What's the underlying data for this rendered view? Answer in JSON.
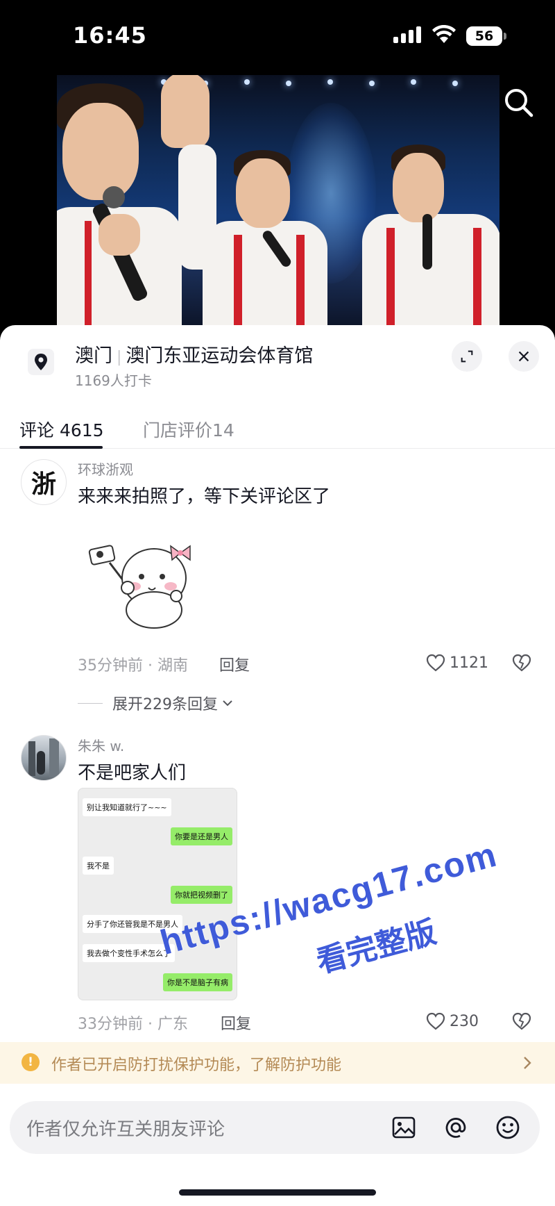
{
  "status_bar": {
    "time": "16:45",
    "battery": "56",
    "battery_level": 0.56
  },
  "location": {
    "city": "澳门",
    "venue": "澳门东亚运动会体育馆",
    "checkins": "1169人打卡"
  },
  "tabs": [
    {
      "label": "评论 4615",
      "active": true
    },
    {
      "label": "门店评价14",
      "active": false
    }
  ],
  "comments": [
    {
      "user": "环球浙观",
      "avatar_text": "浙",
      "text": "来来来拍照了，等下关评论区了",
      "sticker": "selfie-bear-sticker",
      "meta": "35分钟前 · 湖南",
      "reply_label": "回复",
      "likes": "1121"
    },
    {
      "user": "朱朱 w.",
      "text": "不是吧家人们",
      "meta": "33分钟前 · 广东",
      "reply_label": "回复",
      "likes": "230",
      "chat_screenshot": [
        {
          "side": "left",
          "text": "别让我知道就行了~~~"
        },
        {
          "side": "right",
          "text": "你要是还是男人"
        },
        {
          "side": "left",
          "text": "我不是"
        },
        {
          "side": "right",
          "text": "你就把视频删了"
        },
        {
          "side": "left",
          "text": "分手了你还管我是不是男人"
        },
        {
          "side": "left",
          "text": "我去做个变性手术怎么了"
        },
        {
          "side": "right",
          "text": "你是不是脑子有病"
        }
      ]
    }
  ],
  "expand_replies": "展开229条回复",
  "notice": "作者已开启防打扰保护功能，了解防护功能",
  "input": {
    "placeholder": "作者仅允许互关朋友评论"
  },
  "watermark": {
    "line1": "https://wacg17.com",
    "line2": "看完整版"
  },
  "colors": {
    "accent_notice": "#f2b542",
    "watermark": "#3f5bd9",
    "chat_green": "#95ec69"
  }
}
